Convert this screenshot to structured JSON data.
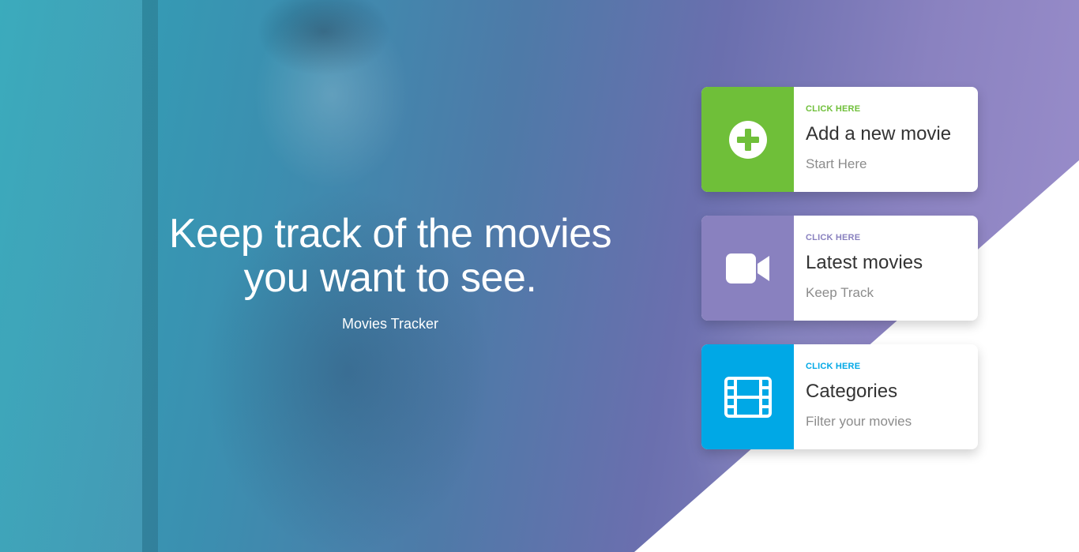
{
  "hero": {
    "headline_line1": "Keep track of the movies",
    "headline_line2": "you want to see.",
    "subtitle": "Movies Tracker"
  },
  "colors": {
    "green": "#6fbf39",
    "purple": "#8981bf",
    "blue": "#00a8e6"
  },
  "cards": [
    {
      "eyebrow": "CLICK HERE",
      "title": "Add a new movie",
      "subtitle": "Start Here",
      "icon": "plus-circle-icon"
    },
    {
      "eyebrow": "CLICK HERE",
      "title": "Latest movies",
      "subtitle": "Keep Track",
      "icon": "video-camera-icon"
    },
    {
      "eyebrow": "CLICK HERE",
      "title": "Categories",
      "subtitle": "Filter your movies",
      "icon": "film-strip-icon"
    }
  ]
}
